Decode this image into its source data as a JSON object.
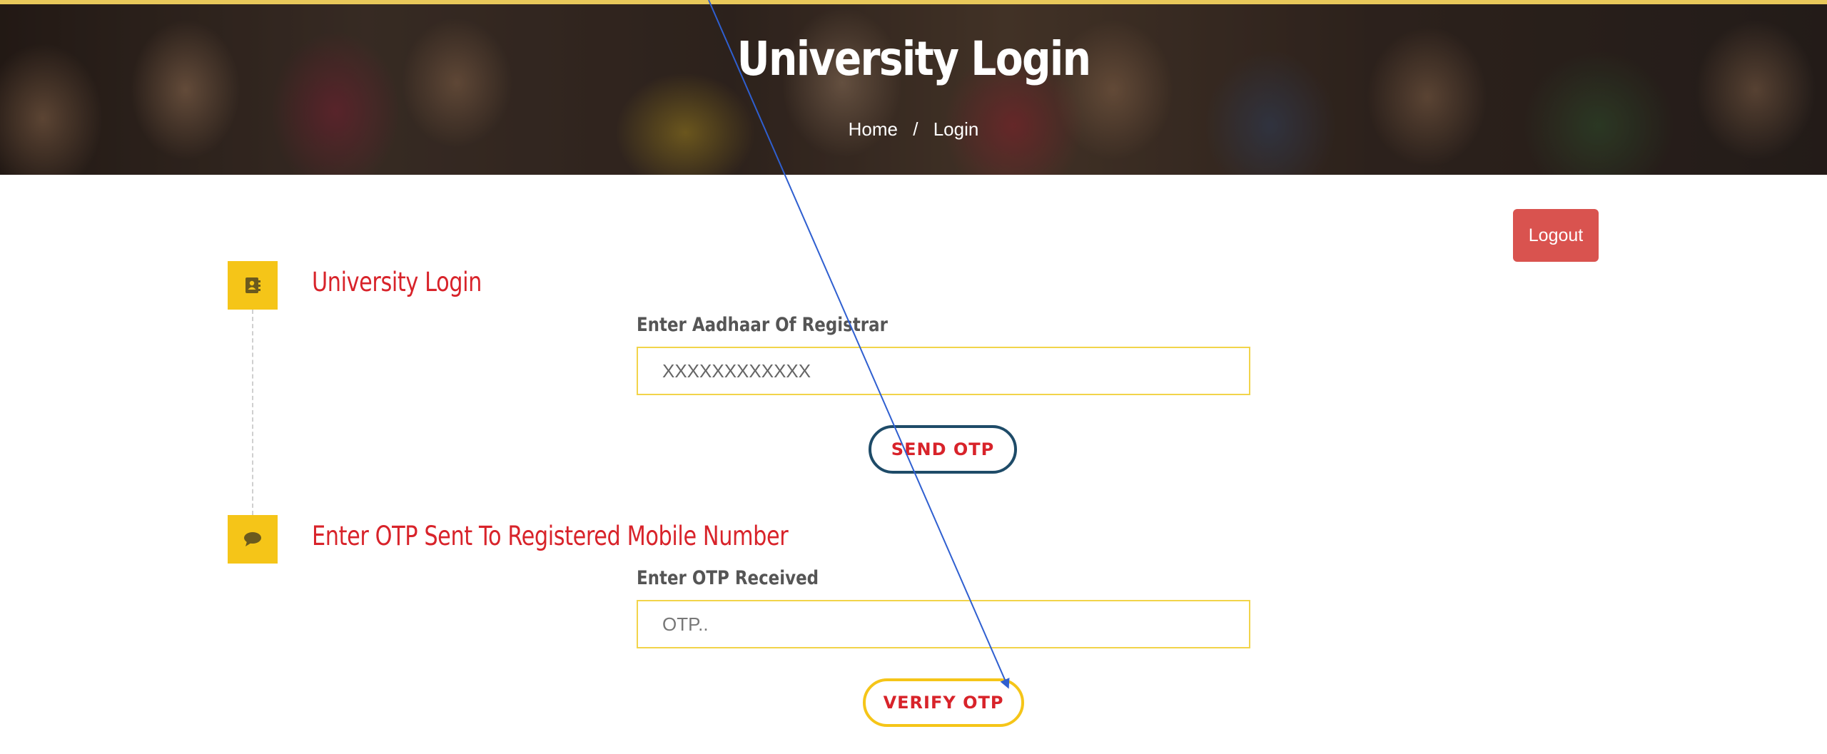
{
  "banner": {
    "title": "University Login",
    "breadcrumb": {
      "home": "Home",
      "separator": "/",
      "current": "Login"
    }
  },
  "header": {
    "logout_label": "Logout"
  },
  "steps": [
    {
      "icon": "contact-book-icon",
      "title": "University Login",
      "field_label": "Enter Aadhaar Of Registrar",
      "input_value": "XXXXXXXXXXXX",
      "input_placeholder": "XXXXXXXXXXXX",
      "button_label": "SEND OTP"
    },
    {
      "icon": "chat-bubble-icon",
      "title": "Enter OTP Sent To Registered Mobile Number",
      "field_label": "Enter OTP Received",
      "input_value": "",
      "input_placeholder": "OTP..",
      "button_label": "VERIFY OTP"
    }
  ],
  "colors": {
    "accent_red": "#d8232a",
    "accent_yellow": "#f5c518",
    "logout_bg": "#d9534f",
    "send_border": "#1e4b68",
    "annotation_arrow": "#2f5fd0"
  }
}
